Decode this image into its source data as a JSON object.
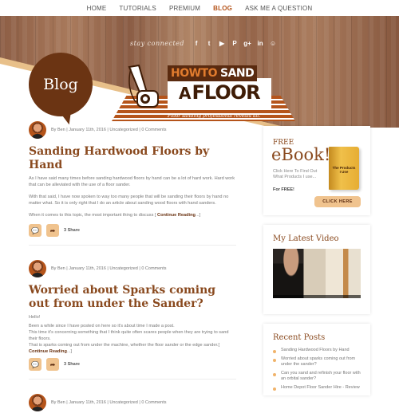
{
  "nav": {
    "items": [
      {
        "label": "HOME",
        "active": false
      },
      {
        "label": "TUTORIALS",
        "active": false
      },
      {
        "label": "PREMIUM",
        "active": false
      },
      {
        "label": "BLOG",
        "active": true
      },
      {
        "label": "ASK ME A QUESTION",
        "active": false
      }
    ]
  },
  "hero": {
    "stay_connected": "stay connected",
    "social_icons": [
      "facebook-icon",
      "twitter-icon",
      "youtube-icon",
      "pinterest-icon",
      "google-plus-icon",
      "linkedin-icon",
      "reddit-icon"
    ],
    "social_glyphs": [
      "f",
      "t",
      "▶",
      "P",
      "g+",
      "in",
      "☺"
    ],
    "bubble_label": "Blog",
    "logo": {
      "how_to": "HOWTO",
      "sand": "SAND",
      "a": "A",
      "floor": "FLOOR",
      "tagline": "Floor sanding professional reveals all."
    }
  },
  "posts": [
    {
      "meta": "By Ben  |  January 11th, 2016  |  Uncategorized  |  0 Comments",
      "title": "Sanding Hardwood Floors by Hand",
      "paragraphs": [
        "As I have said many times before sanding hardwood floors by hand can be a lot of hard work. Hard work that can be alleviated with the use of a floor sander.",
        "With that said, I have now spoken to way too many people that will be sanding their floors by hand no matter what. So it is only right that I do an article about sanding wood floors with hand sanders."
      ],
      "excerpt_end": "When it comes to this topic, the most important thing to discuss [ ",
      "continue": "Continue Reading",
      "continue_suffix": "...]",
      "share": "3 Share"
    },
    {
      "meta": "By Ben  |  January 11th, 2016  |  Uncategorized  |  0 Comments",
      "title": "Worried about Sparks coming out from under the Sander?",
      "paragraphs": [
        "Hello!"
      ],
      "lines": [
        "Been a while since I have posted on here so it's about time I made a post.",
        "This time it's concerning something that I think quite often scares people when they are trying to sand their floors.",
        "That is sparks coming out from under the machine, whether the floor sander or the edge sander.[ "
      ],
      "continue": "Continue Reading",
      "continue_suffix": "...]",
      "share": "3 Share"
    },
    {
      "meta": "By Ben  |  January 11th, 2016  |  Uncategorized  |  0 Comments"
    }
  ],
  "sidebar": {
    "ebook": {
      "free": "FREE",
      "title": "eBook!",
      "subtitle": "Click Here To Find Out What Products I use...",
      "for_free": "For FREE!",
      "book_label": "The Products I Use",
      "button": "CLICK HERE"
    },
    "video": {
      "title": "My Latest Video"
    },
    "recent": {
      "title": "Recent Posts",
      "items": [
        "Sanding Hardwood Floors by Hand",
        "Worried about sparks coming out from under the sander?",
        "Can you sand and refinish your floor with an orbital sander?",
        "Home Depot Floor Sander Hire - Review"
      ]
    }
  }
}
